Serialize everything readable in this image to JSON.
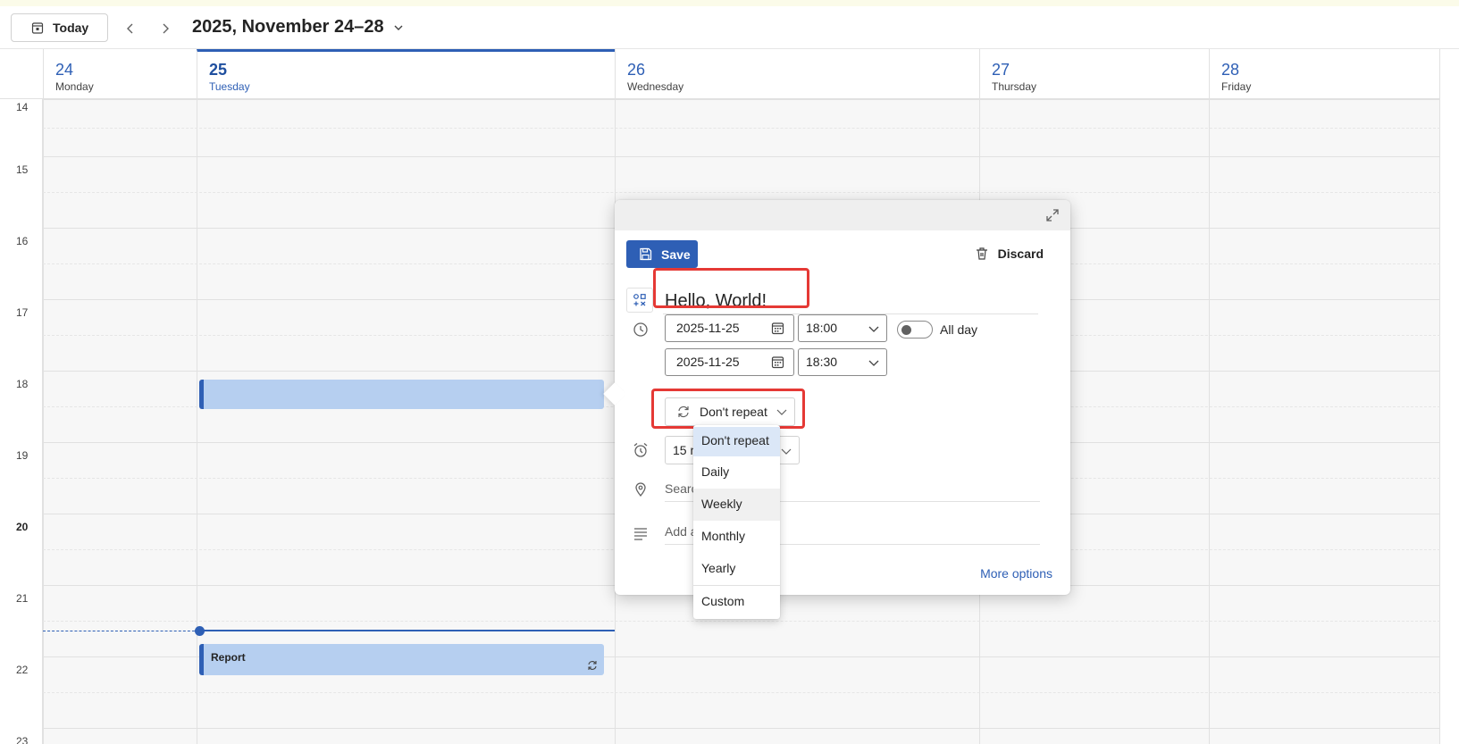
{
  "toolbar": {
    "today_label": "Today",
    "date_range": "2025, November 24–28"
  },
  "days": [
    {
      "num": "24",
      "name": "Monday"
    },
    {
      "num": "25",
      "name": "Tuesday",
      "today": true
    },
    {
      "num": "26",
      "name": "Wednesday"
    },
    {
      "num": "27",
      "name": "Thursday"
    },
    {
      "num": "28",
      "name": "Friday"
    }
  ],
  "hours": [
    "14",
    "15",
    "16",
    "17",
    "18",
    "19",
    "20",
    "21",
    "22",
    "23"
  ],
  "events": {
    "new_event_title": "",
    "report_title": "Report"
  },
  "popup": {
    "save_label": "Save",
    "discard_label": "Discard",
    "title_value": "Hello, World!",
    "start_date": "2025-11-25",
    "start_time": "18:00",
    "end_date": "2025-11-25",
    "end_time": "18:30",
    "all_day_label": "All day",
    "repeat_value": "Don't repeat",
    "reminder_value": "15 m",
    "location_placeholder": "Searc",
    "description_placeholder": "Add a",
    "more_options_label": "More options"
  },
  "repeat_options": [
    "Don't repeat",
    "Daily",
    "Weekly",
    "Monthly",
    "Yearly",
    "Custom"
  ],
  "colors": {
    "accent": "#2e5fb5",
    "event_fill": "#b6cff0",
    "highlight_box": "#e53935"
  }
}
